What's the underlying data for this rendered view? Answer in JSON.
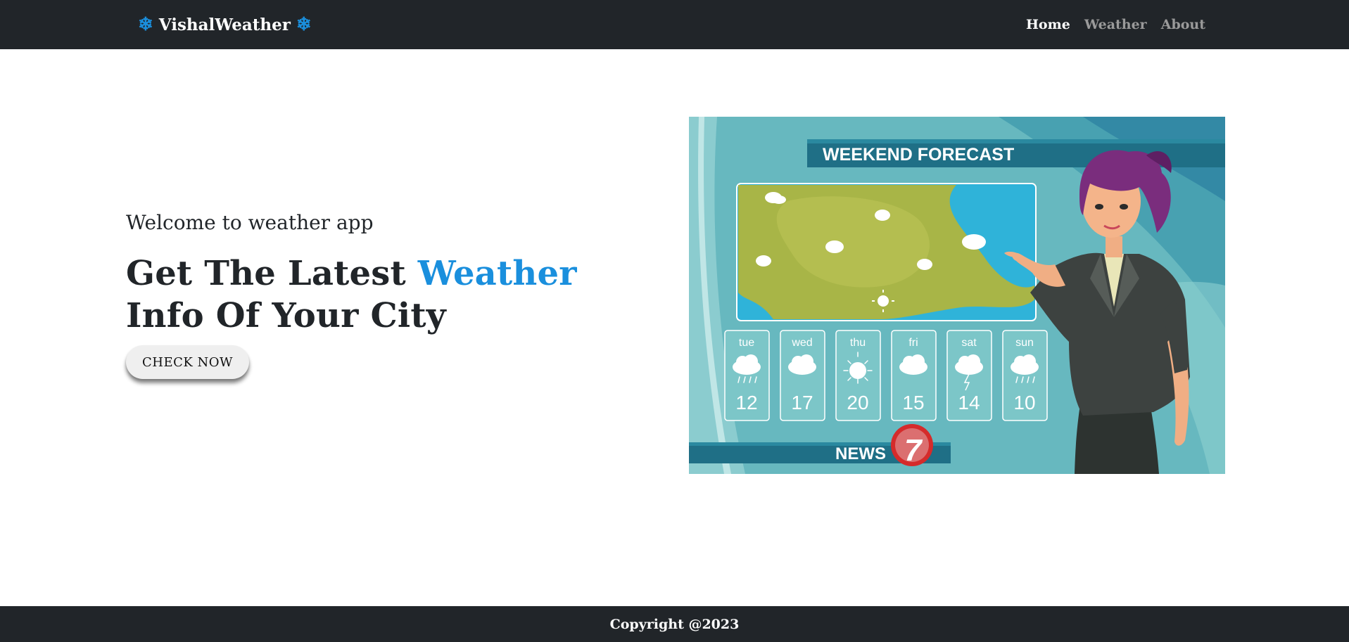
{
  "app": {
    "brand_icon": "❄",
    "brand_name": "VishalWeather",
    "accent_color": "#1a8fdd",
    "nav_background": "#212529"
  },
  "nav": {
    "items": [
      {
        "label": "Home",
        "active": true
      },
      {
        "label": "Weather",
        "active": false
      },
      {
        "label": "About",
        "active": false
      }
    ]
  },
  "hero": {
    "subtitle": "Welcome to weather app",
    "headline_before": "Get The Latest ",
    "headline_accent": "Weather",
    "headline_after": " Info Of Your City",
    "cta_label": "CHECK NOW"
  },
  "illustration": {
    "banner_title": "WEEKEND FORECAST",
    "forecast": [
      {
        "day": "tue",
        "temp": "12",
        "icon": "rain-cloud-icon"
      },
      {
        "day": "wed",
        "temp": "17",
        "icon": "cloud-icon"
      },
      {
        "day": "thu",
        "temp": "20",
        "icon": "sun-icon"
      },
      {
        "day": "fri",
        "temp": "15",
        "icon": "cloud-icon"
      },
      {
        "day": "sat",
        "temp": "14",
        "icon": "storm-cloud-icon"
      },
      {
        "day": "sun",
        "temp": "10",
        "icon": "rain-cloud-icon"
      }
    ],
    "news_label": "NEWS",
    "news_number": "7"
  },
  "footer": {
    "copyright": "Copyright @2023"
  }
}
